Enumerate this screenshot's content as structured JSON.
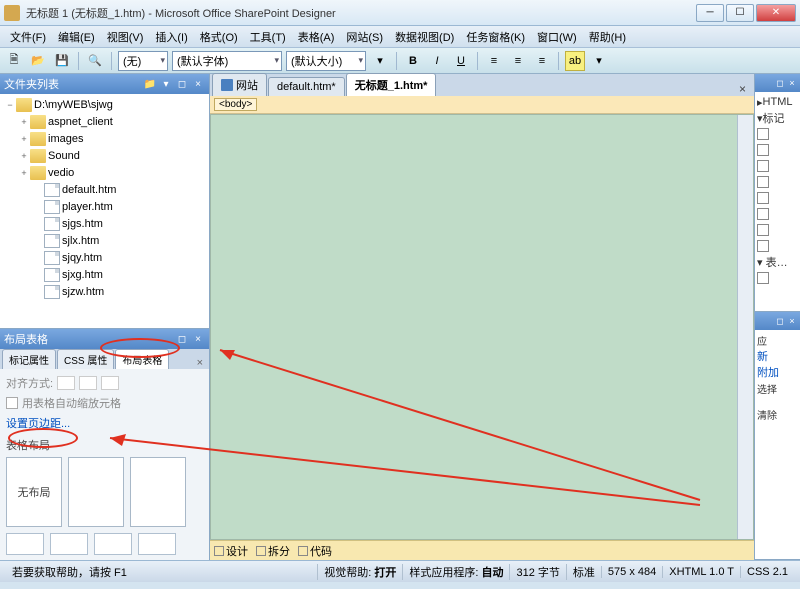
{
  "window": {
    "title": "无标题 1 (无标题_1.htm) - Microsoft Office SharePoint Designer"
  },
  "menu": {
    "file": "文件(F)",
    "edit": "编辑(E)",
    "view": "视图(V)",
    "insert": "插入(I)",
    "format": "格式(O)",
    "tools": "工具(T)",
    "table": "表格(A)",
    "site": "网站(S)",
    "dataview": "数据视图(D)",
    "taskpanes": "任务窗格(K)",
    "window": "窗口(W)",
    "help": "帮助(H)"
  },
  "toolbar": {
    "style": "(无)",
    "font": "(默认字体)",
    "size": "(默认大小)",
    "bold": "B",
    "italic": "I",
    "underline": "U"
  },
  "panels": {
    "folderList": "文件夹列表",
    "layoutTables": "布局表格"
  },
  "tree": {
    "root": "D:\\myWEB\\sjwg",
    "folders": [
      "aspnet_client",
      "images",
      "Sound",
      "vedio"
    ],
    "files": [
      "default.htm",
      "player.htm",
      "sjgs.htm",
      "sjlx.htm",
      "sjqy.htm",
      "sjxg.htm",
      "sjzw.htm"
    ]
  },
  "layoutTabs": {
    "t1": "标记属性",
    "t2": "CSS 属性",
    "t3": "布局表格"
  },
  "layout": {
    "alignLabel": "对齐方式:",
    "autoScale": "用表格自动缩放元格",
    "setMargins": "设置页边距...",
    "tableLayout": "表格布局",
    "noLayout": "无布局"
  },
  "docTabs": {
    "site": "网站",
    "t1": "default.htm*",
    "t2": "无标题_1.htm*"
  },
  "breadcrumb": {
    "body": "<body>"
  },
  "viewTabs": {
    "design": "设计",
    "split": "拆分",
    "code": "代码"
  },
  "rightPanel": {
    "html": "HTML",
    "tags": "标记",
    "apply": "应",
    "new": "新",
    "attach": "附加",
    "select": "选择",
    "clear": "清除"
  },
  "status": {
    "help": "若要获取帮助，请按 F1",
    "visHelp": "视觉帮助:",
    "visHelpVal": "打开",
    "styleApp": "样式应用程序:",
    "styleAppVal": "自动",
    "bytes": "312 字节",
    "std": "标准",
    "dims": "575 x 484",
    "doctype": "XHTML 1.0 T",
    "css": "CSS 2.1"
  }
}
